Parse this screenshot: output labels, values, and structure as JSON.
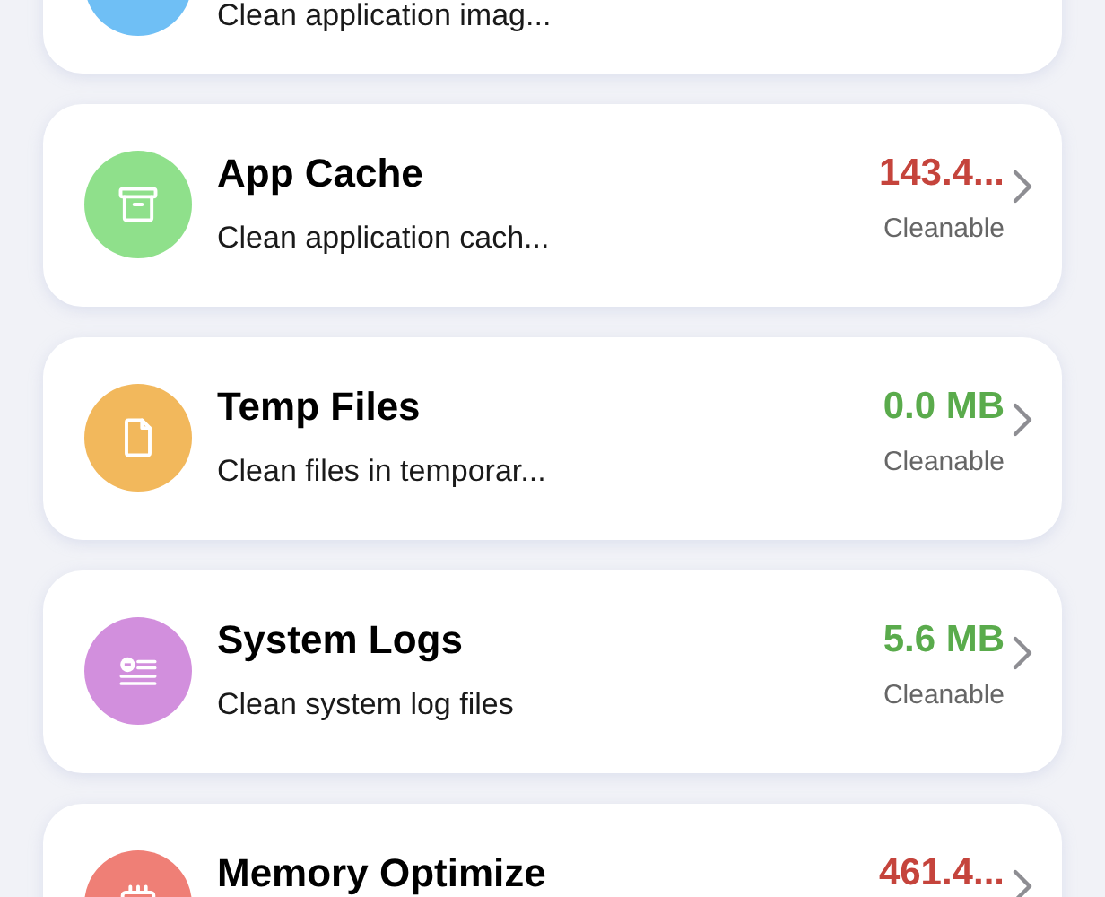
{
  "items": [
    {
      "subtitle": "Clean application imag...",
      "color": "#6fbff5"
    },
    {
      "title": "App Cache",
      "subtitle": "Clean application cach...",
      "value": "143.4...",
      "kind": "large",
      "status": "Cleanable",
      "color": "#8fe08b"
    },
    {
      "title": "Temp Files",
      "subtitle": "Clean files in temporar...",
      "value": "0.0 MB",
      "kind": "small",
      "status": "Cleanable",
      "color": "#f2b85c"
    },
    {
      "title": "System Logs",
      "subtitle": "Clean system log files",
      "value": "5.6 MB",
      "kind": "small",
      "status": "Cleanable",
      "color": "#d28fdd"
    },
    {
      "title": "Memory Optimize",
      "value": "461.4...",
      "kind": "large",
      "color": "#ef7f76"
    }
  ]
}
